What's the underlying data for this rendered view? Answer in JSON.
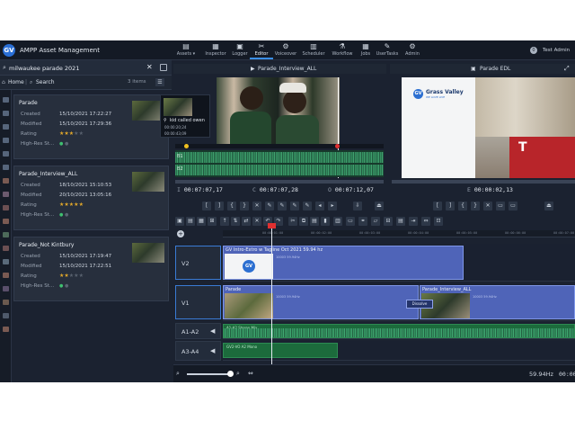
{
  "app": {
    "title": "AMPP Asset Management",
    "logo": "GV"
  },
  "nav": [
    {
      "label": "Assets",
      "icon": "assets-icon",
      "glyph": "▤"
    },
    {
      "label": "Inspector",
      "icon": "inspector-icon",
      "glyph": "▦"
    },
    {
      "label": "Logger",
      "icon": "logger-icon",
      "glyph": "▣"
    },
    {
      "label": "Editor",
      "icon": "editor-icon",
      "glyph": "✂",
      "active": true
    },
    {
      "label": "Voiceover",
      "icon": "voiceover-icon",
      "glyph": "⚙"
    },
    {
      "label": "Scheduler",
      "icon": "scheduler-icon",
      "glyph": "▥"
    },
    {
      "label": "Workflow",
      "icon": "workflow-icon",
      "glyph": "⚗"
    },
    {
      "label": "Jobs",
      "icon": "jobs-icon",
      "glyph": "▦"
    },
    {
      "label": "UserTasks",
      "icon": "usertasks-icon",
      "glyph": "✎"
    },
    {
      "label": "Admin",
      "icon": "admin-icon",
      "glyph": "⚙"
    }
  ],
  "user": {
    "name": "Test Admin",
    "badge": "0"
  },
  "search": {
    "value": "milwaukee parade 2021"
  },
  "breadcrumb": {
    "home": "Home",
    "current": "Search",
    "count": "3 items"
  },
  "field_labels": {
    "created": "Created",
    "modified": "Modified",
    "rating": "Rating",
    "hires": "High-Res St..."
  },
  "assets": [
    {
      "title": "Parade",
      "created": "15/10/2021 17:22:27",
      "modified": "15/10/2021 17:29:36",
      "rating": 3,
      "hires": 2
    },
    {
      "title": "Parade_Interview_ALL",
      "created": "18/10/2021 15:10:53",
      "modified": "20/10/2021 13:05:16",
      "rating": 5,
      "hires": 2
    },
    {
      "title": "Parade_Not Kintbury",
      "created": "15/10/2021 17:19:47",
      "modified": "15/10/2021 17:22:51",
      "rating": 2,
      "hires": 2
    }
  ],
  "tooltip": {
    "title": "kid called owen",
    "in": "00:00:20;24",
    "out": "00:00:43;09"
  },
  "source": {
    "title": "Parade_Interview_ALL",
    "tracks": [
      "B1",
      "B2"
    ],
    "tc_in": "00:07:07,17",
    "tc_dur": "00:07:07,28",
    "tc_out": "00:07:12,07",
    "tc_prefixes": [
      "I",
      "C",
      "O"
    ]
  },
  "program": {
    "title": "Parade EDL",
    "brand": "Grass Valley",
    "brand_sub": "WE LOVE LIVE",
    "tc": "00:00:02,13",
    "tc_prefix": "E",
    "truck_mark": "T"
  },
  "timeline": {
    "ruler": [
      "00:00:01:00",
      "00:00:02:00",
      "00:00:03:00",
      "00:00:04:00",
      "00:00:05:00",
      "00:00:06:00",
      "00:00:07:00"
    ],
    "tracks": [
      {
        "name": "V2"
      },
      {
        "name": "V1"
      },
      {
        "name": "A1-A2"
      },
      {
        "name": "A3-A4"
      }
    ],
    "clips": {
      "v2": {
        "name": "GV Intro-Extro w Tagline Oct 2021 59.94 hz",
        "tc": "10003 59.94Hz"
      },
      "v1a": {
        "name": "Parade",
        "tc": "10003 59.94Hz"
      },
      "v1b": {
        "name": "Parade_Interview_ALL",
        "tc": "10003 59.94Hz"
      },
      "dissolve": "Dissolve",
      "a1": {
        "name": "A1-A2 Stereo Mix"
      },
      "a3": {
        "name": "GV2-VO A2 Mono"
      }
    }
  },
  "status": {
    "framerate": "59.94Hz",
    "tc": "00:00"
  }
}
